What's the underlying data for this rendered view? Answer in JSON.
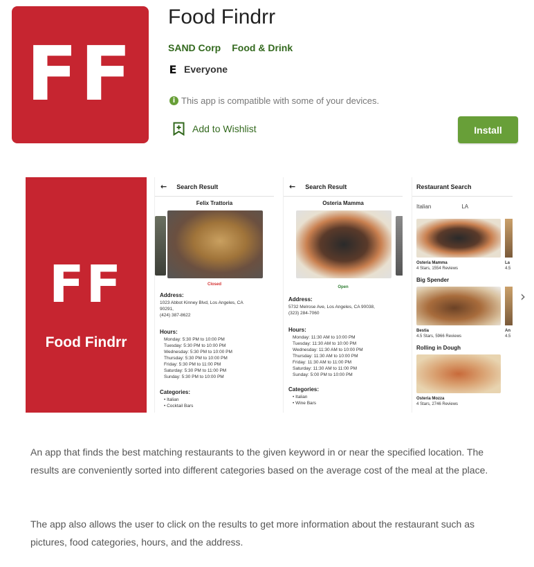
{
  "app": {
    "icon_text": "FF",
    "title": "Food Findrr",
    "developer": "SAND Corp",
    "category": "Food & Drink",
    "content_rating": "Everyone",
    "compat_text": "This app is compatible with some of your devices.",
    "wishlist_label": "Add to Wishlist",
    "install_label": "Install",
    "colors": {
      "brand_red": "#c62530",
      "accent_green": "#689f38",
      "link_green": "#33691e"
    }
  },
  "screenshots": {
    "brand": {
      "ff": "FF",
      "name": "Food Findrr"
    },
    "shot1": {
      "bar_title": "Search Result",
      "name": "Felix Trattoria",
      "status": "Closed",
      "address_heading": "Address:",
      "address": [
        "1023 Abbot Kinney Blvd, Los Angeles, CA",
        "90291,",
        "(424) 387-8622"
      ],
      "hours_heading": "Hours:",
      "hours": [
        "Monday: 5:30 PM to 10:00 PM",
        "Tuesday: 5:30 PM to 10:00 PM",
        "Wednesday: 5:30 PM to 10:00 PM",
        "Thursday: 5:30 PM to 10:00 PM",
        "Friday: 5:30 PM to 11:00 PM",
        "Saturday: 5:30 PM to 11:00 PM",
        "Sunday: 5:30 PM to 10:00 PM"
      ],
      "categories_heading": "Categories:",
      "categories": [
        "• Italian",
        "• Cocktail Bars"
      ]
    },
    "shot2": {
      "bar_title": "Search Result",
      "name": "Osteria Mamma",
      "status": "Open",
      "address_heading": "Address:",
      "address": [
        "5732 Melrose Ave, Los Angeles, CA 90038,",
        "(323) 284-7060"
      ],
      "hours_heading": "Hours:",
      "hours": [
        "Monday: 11:30 AM to 10:00 PM",
        "Tuesday: 11:30 AM to 10:00 PM",
        "Wednesday: 11:30 AM to 10:00 PM",
        "Thursday: 11:30 AM to 10:00 PM",
        "Friday: 11:30 AM to 11:00 PM",
        "Saturday: 11:30 AM to 11:00 PM",
        "Sunday: 5:00 PM to 10:00 PM"
      ],
      "categories_heading": "Categories:",
      "categories": [
        "• Italian",
        "• Wine Bars"
      ]
    },
    "shot3": {
      "bar_title": "Restaurant Search",
      "keyword": "Italian",
      "location": "LA",
      "item1_name": "Osteria Mamma",
      "item1_rating": "4 Stars, 1554 Reviews",
      "item1b_name": "La",
      "item1b_rating": "4.5",
      "section2": "Big Spender",
      "item2_name": "Bestia",
      "item2_rating": "4.5 Stars, 5966 Reviews",
      "item2b_name": "An",
      "item2b_rating": "4.5",
      "section3": "Rolling in Dough",
      "item3_name": "Osteria Mozza",
      "item3_rating": "4 Stars, 2746 Reviews"
    }
  },
  "description": {
    "p1": "An app that finds the best matching restaurants to the given keyword in or near the specified location. The results are conveniently sorted into different categories based on the average cost of the meal at the place.",
    "p2": "The app also allows the user to click on the results to get more information about the restaurant such as pictures, food categories, hours, and the address."
  }
}
